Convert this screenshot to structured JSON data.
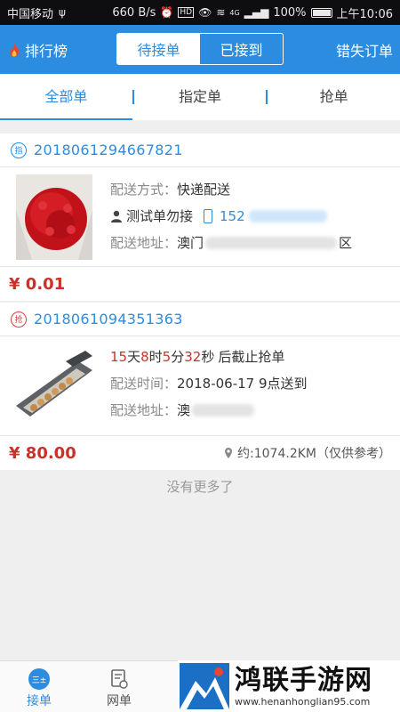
{
  "status_bar": {
    "carrier": "中国移动",
    "usb": "ψ",
    "speed": "660 B/s",
    "battery": "100%",
    "time": "上午10:06",
    "hd_badge": "HD",
    "signal_tag": "4G"
  },
  "header": {
    "rank_label": "排行榜",
    "tab_pending": "待接单",
    "tab_received": "已接到",
    "lost_orders": "错失订单"
  },
  "filter_tabs": [
    "全部单",
    "指定单",
    "抢单"
  ],
  "orders": [
    {
      "tag": "指",
      "order_no": "2018061294667821",
      "delivery_method_label": "配送方式：",
      "delivery_method": "快递配送",
      "contact_name": "测试单勿接",
      "phone_prefix": "152",
      "address_label": "配送地址：",
      "address_start": "澳门",
      "address_end": "区",
      "price": "¥ 0.01"
    },
    {
      "tag": "抢",
      "order_no": "2018061094351363",
      "countdown": {
        "days": "15",
        "days_unit": "天",
        "hours": "8",
        "hours_unit": "时",
        "minutes": "5",
        "minutes_unit": "分",
        "seconds": "32",
        "seconds_unit": "秒",
        "suffix": "后截止抢单"
      },
      "delivery_time_label": "配送时间：",
      "delivery_time": "2018-06-17 9点送到",
      "address_label": "配送地址：",
      "address_start": "澳",
      "price": "¥ 80.00",
      "distance": "约:1074.2KM（仅供参考）"
    }
  ],
  "no_more": "没有更多了",
  "bottom_nav": {
    "receive": "接单",
    "receive_icon_text": "三±",
    "web_orders": "网单"
  },
  "watermark": {
    "title": "鸿联手游网",
    "url": "www.henanhonglian95.com"
  },
  "colors": {
    "primary": "#2c8ce0",
    "price_red": "#c8322a",
    "status_bar_bg": "#0e0e10"
  }
}
